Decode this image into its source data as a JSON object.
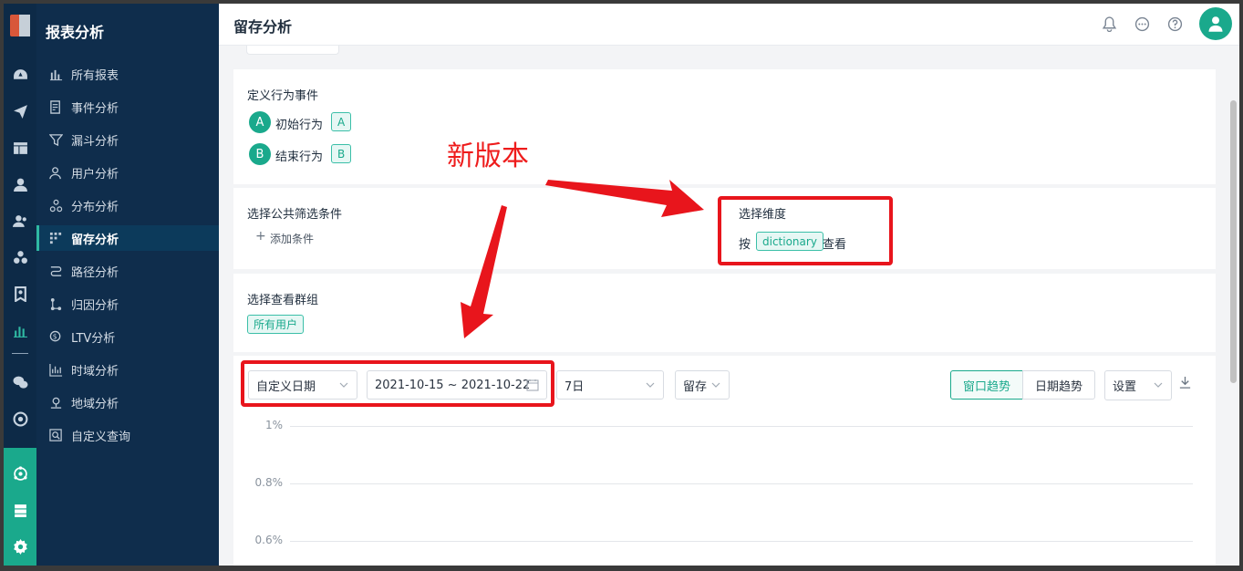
{
  "sidebar": {
    "title": "报表分析",
    "items": [
      {
        "label": "所有报表",
        "icon": "bar-chart-icon"
      },
      {
        "label": "事件分析",
        "icon": "event-icon"
      },
      {
        "label": "漏斗分析",
        "icon": "funnel-icon"
      },
      {
        "label": "用户分析",
        "icon": "user-icon"
      },
      {
        "label": "分布分析",
        "icon": "distribution-icon"
      },
      {
        "label": "留存分析",
        "icon": "retention-grid-icon",
        "active": true
      },
      {
        "label": "路径分析",
        "icon": "path-icon"
      },
      {
        "label": "归因分析",
        "icon": "attribution-icon"
      },
      {
        "label": "LTV分析",
        "icon": "ltv-icon"
      },
      {
        "label": "时域分析",
        "icon": "time-chart-icon"
      },
      {
        "label": "地域分析",
        "icon": "location-icon"
      },
      {
        "label": "自定义查询",
        "icon": "custom-query-icon"
      }
    ]
  },
  "header": {
    "title": "留存分析"
  },
  "behavior": {
    "label": "定义行为事件",
    "start": {
      "letter": "A",
      "label": "初始行为",
      "tag": "A"
    },
    "end": {
      "letter": "B",
      "label": "结束行为",
      "tag": "B"
    }
  },
  "filter": {
    "label": "选择公共筛选条件",
    "add": "添加条件"
  },
  "dimension": {
    "label": "选择维度",
    "prefix": "按",
    "tag": "dictionary",
    "suffix": "查看"
  },
  "group": {
    "label": "选择查看群组",
    "tag": "所有用户"
  },
  "toolbar": {
    "date_mode": "自定义日期",
    "date_range": "2021-10-15 ~ 2021-10-22",
    "period": "7日",
    "metric": "留存",
    "window_trend": "窗口趋势",
    "date_trend": "日期趋势",
    "settings": "设置"
  },
  "chart_data": {
    "type": "line",
    "y_ticks": [
      "1%",
      "0.8%",
      "0.6%"
    ],
    "grid": true
  },
  "annotation": {
    "text": "新版本"
  },
  "colors": {
    "accent": "#1aa98c",
    "sidebar": "#0f2d4c",
    "annotation": "#e8151c"
  }
}
